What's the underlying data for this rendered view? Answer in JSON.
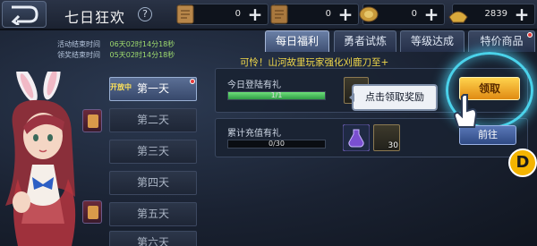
{
  "header": {
    "title": "七日狂欢",
    "help_label": "?",
    "resources": [
      {
        "icon": "scroll-icon",
        "value": "0",
        "plus": "+"
      },
      {
        "icon": "scroll-icon",
        "value": "0",
        "plus": "+"
      },
      {
        "icon": "coin-icon",
        "value": "0",
        "plus": "+"
      },
      {
        "icon": "ingot-icon",
        "value": "2839",
        "plus": "+"
      }
    ]
  },
  "info": {
    "event_end_label": "活动结束时间",
    "event_end_value": "06天02时14分18秒",
    "claim_end_label": "领奖结束时间",
    "claim_end_value": "05天02时14分18秒"
  },
  "tabs": [
    {
      "label": "每日福利",
      "active": true,
      "dot": false
    },
    {
      "label": "勇者试炼",
      "active": false,
      "dot": false
    },
    {
      "label": "等级达成",
      "active": false,
      "dot": false
    },
    {
      "label": "特价商品",
      "active": false,
      "dot": true
    }
  ],
  "marquee": "可怜！山河故里玩家强化刈鹿刀至+",
  "days": [
    {
      "label": "第一天",
      "open_tag": "开放中",
      "active": true,
      "dot": true
    },
    {
      "label": "第二天",
      "open_tag": "",
      "active": false,
      "dot": false
    },
    {
      "label": "第三天",
      "open_tag": "",
      "active": false,
      "dot": false
    },
    {
      "label": "第四天",
      "open_tag": "",
      "active": false,
      "dot": false
    },
    {
      "label": "第五天",
      "open_tag": "",
      "active": false,
      "dot": false
    },
    {
      "label": "第六天",
      "open_tag": "",
      "active": false,
      "dot": false
    }
  ],
  "tasks": [
    {
      "title": "今日登陆有礼",
      "progress_text": "1/1",
      "progress": 1.0,
      "button": "领取"
    },
    {
      "title": "累计充值有礼",
      "progress_text": "0/30",
      "progress": 0.0,
      "button": "前往",
      "item_count": "30"
    }
  ],
  "tooltip": "点击领取奖励",
  "badge": "D",
  "colors": {
    "accent": "#f4b400",
    "highlight": "#50e6ff",
    "marquee": "#f2d94a"
  }
}
